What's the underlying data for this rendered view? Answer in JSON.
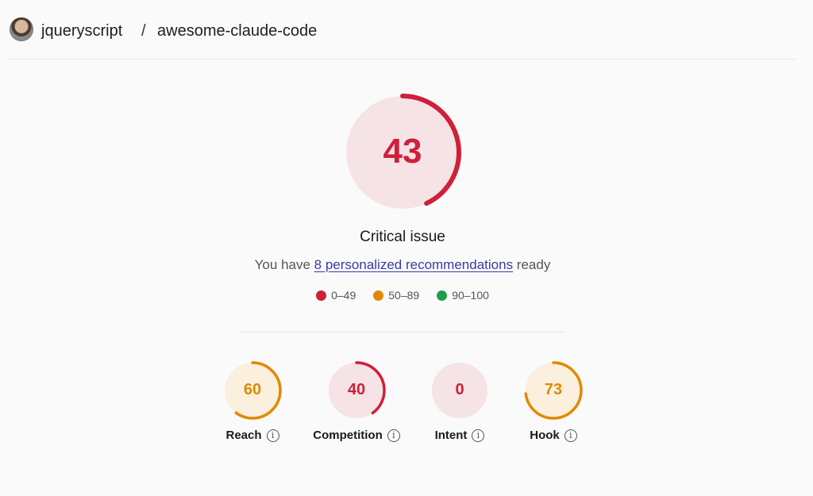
{
  "header": {
    "owner": "jqueryscript",
    "separator": "/",
    "repo": "awesome-claude-code"
  },
  "overall": {
    "score": "43",
    "score_value": 43,
    "color": "#cf1f3a",
    "track_color": "#f5e3e6",
    "status": "Critical issue",
    "recs_prefix": "You have ",
    "recs_link": "8 personalized recommendations",
    "recs_suffix": " ready"
  },
  "legend": [
    {
      "label": "0–49",
      "color": "#cf1f3a"
    },
    {
      "label": "50–89",
      "color": "#e08a00"
    },
    {
      "label": "90–100",
      "color": "#1e9e4a"
    }
  ],
  "metrics": [
    {
      "label": "Reach",
      "score": "60",
      "value": 60,
      "color": "#e08a00",
      "track": "#fbefdd",
      "icon": "info-icon"
    },
    {
      "label": "Competition",
      "score": "40",
      "value": 40,
      "color": "#cf1f3a",
      "track": "#f5e3e6",
      "icon": "info-icon"
    },
    {
      "label": "Intent",
      "score": "0",
      "value": 0,
      "color": "#cf1f3a",
      "track": "#f5e3e6",
      "icon": "info-icon"
    },
    {
      "label": "Hook",
      "score": "73",
      "value": 73,
      "color": "#e08a00",
      "track": "#fbefdd",
      "icon": "info-icon"
    }
  ]
}
